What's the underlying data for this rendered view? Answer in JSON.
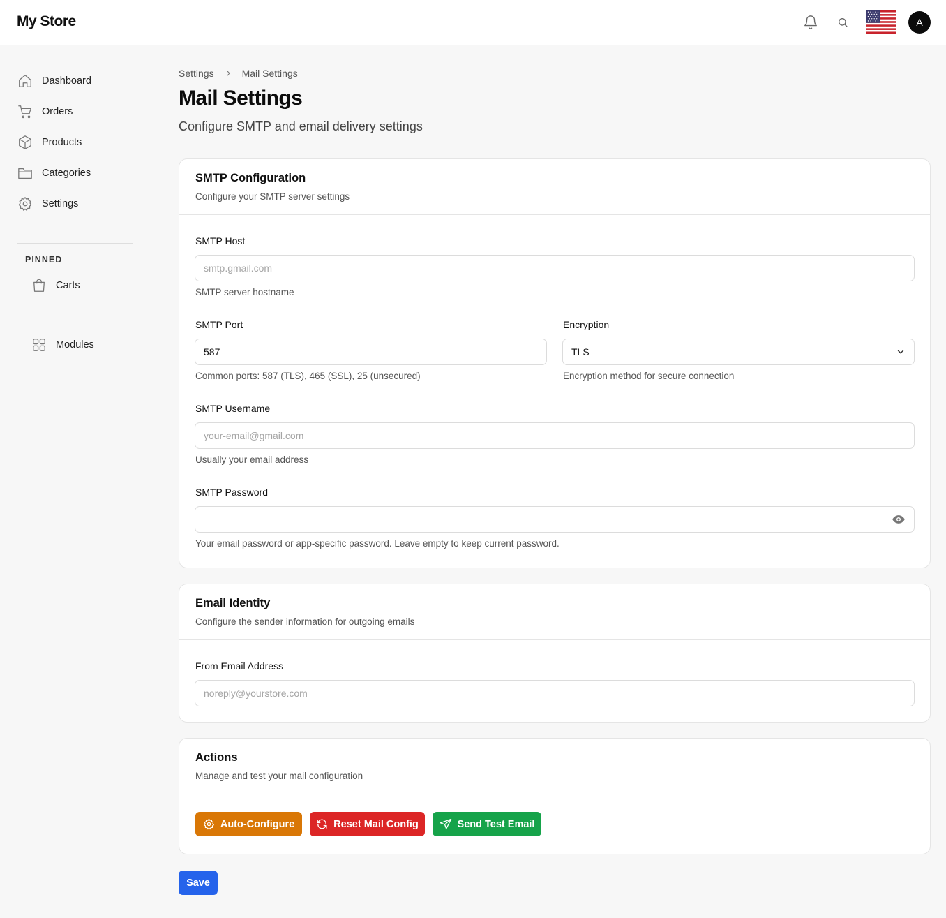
{
  "header": {
    "brand": "My Store",
    "avatar_letter": "A"
  },
  "sidebar": {
    "items": [
      {
        "label": "Dashboard",
        "icon": "home-icon"
      },
      {
        "label": "Orders",
        "icon": "cart-icon"
      },
      {
        "label": "Products",
        "icon": "box-icon"
      },
      {
        "label": "Categories",
        "icon": "folder-icon"
      },
      {
        "label": "Settings",
        "icon": "gear-icon"
      }
    ],
    "pinned_title": "PINNED",
    "pinned": [
      {
        "label": "Carts",
        "icon": "shopping-bag-icon"
      }
    ],
    "modules": {
      "label": "Modules",
      "icon": "grid-icon"
    }
  },
  "breadcrumb": {
    "parent": "Settings",
    "current": "Mail Settings"
  },
  "page": {
    "title": "Mail Settings",
    "subtitle": "Configure SMTP and email delivery settings"
  },
  "smtp": {
    "title": "SMTP Configuration",
    "description": "Configure your SMTP server settings",
    "host": {
      "label": "SMTP Host",
      "value": "",
      "placeholder": "smtp.gmail.com",
      "help": "SMTP server hostname"
    },
    "port": {
      "label": "SMTP Port",
      "value": "587",
      "placeholder": "",
      "help": "Common ports: 587 (TLS), 465 (SSL), 25 (unsecured)"
    },
    "encryption": {
      "label": "Encryption",
      "value": "TLS",
      "help": "Encryption method for secure connection"
    },
    "username": {
      "label": "SMTP Username",
      "value": "",
      "placeholder": "your-email@gmail.com",
      "help": "Usually your email address"
    },
    "password": {
      "label": "SMTP Password",
      "value": "",
      "help": "Your email password or app-specific password. Leave empty to keep current password."
    }
  },
  "identity": {
    "title": "Email Identity",
    "description": "Configure the sender information for outgoing emails",
    "from": {
      "label": "From Email Address",
      "value": "",
      "placeholder": "noreply@yourstore.com"
    }
  },
  "actions": {
    "title": "Actions",
    "description": "Manage and test your mail configuration",
    "auto_configure": "Auto-Configure",
    "reset": "Reset Mail Config",
    "send_test": "Send Test Email"
  },
  "save_label": "Save",
  "colors": {
    "orange": "#d97706",
    "red": "#dc2626",
    "green": "#16a34a",
    "blue": "#2563eb"
  }
}
